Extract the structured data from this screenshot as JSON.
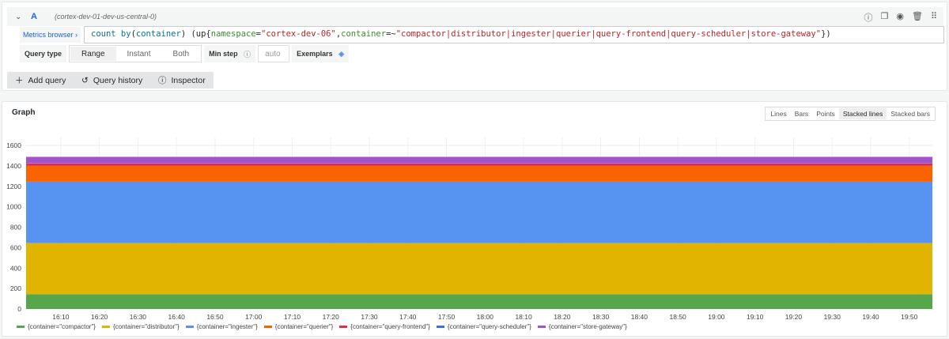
{
  "query": {
    "collapse_icon": "chevron-down-icon",
    "name": "A",
    "datasource": "(cortex-dev-01-dev-us-central-0)",
    "metrics_browser": "Metrics browser ›",
    "expr": {
      "fn": "count by",
      "lp1": "(",
      "arg": "container",
      "rp1": ")",
      " sp": " ",
      "up": "(up{",
      "k1": "namespace",
      "eq1": "=",
      "v1": "\"cortex-dev-06\"",
      "comma": ",",
      "k2": "container",
      "eq2": "=~",
      "v2": "\"compactor|distributor|ingester|querier|query-frontend|query-scheduler|store-gateway\"",
      "end": "})"
    },
    "query_type_label": "Query type",
    "query_types": [
      "Range",
      "Instant",
      "Both"
    ],
    "selected_type": "Range",
    "min_step_label": "Min step",
    "min_step_placeholder": "auto",
    "exemplars_label": "Exemplars"
  },
  "actions": {
    "add_query": "Add query",
    "query_history": "Query history",
    "inspector": "Inspector"
  },
  "graph": {
    "title": "Graph",
    "modes": [
      "Lines",
      "Bars",
      "Points",
      "Stacked lines",
      "Stacked bars"
    ],
    "selected_mode": "Stacked lines"
  },
  "chart_data": {
    "type": "area",
    "stacked": true,
    "grid": true,
    "legend_placement": "bottom",
    "x_range": [
      "16:01",
      "19:56"
    ],
    "x_ticks": [
      "16:10",
      "16:20",
      "16:30",
      "16:40",
      "16:50",
      "17:00",
      "17:10",
      "17:20",
      "17:30",
      "17:40",
      "17:50",
      "18:00",
      "18:10",
      "18:20",
      "18:30",
      "18:40",
      "18:50",
      "19:00",
      "19:10",
      "19:20",
      "19:30",
      "19:40",
      "19:50"
    ],
    "y_ticks": [
      0,
      200,
      400,
      600,
      800,
      1000,
      1200,
      1400,
      1600
    ],
    "ylim": [
      0,
      1650
    ],
    "series": [
      {
        "name": "{container=\"compactor\"}",
        "value": 145,
        "color": "#56a64b"
      },
      {
        "name": "{container=\"distributor\"}",
        "value": 500,
        "color": "#e0b400"
      },
      {
        "name": "{container=\"ingester\"}",
        "value": 600,
        "color": "#5794f2"
      },
      {
        "name": "{container=\"querier\"}",
        "value": 155,
        "color": "#fa6400"
      },
      {
        "name": "{container=\"query-frontend\"}",
        "value": 24,
        "color": "#e02f44"
      },
      {
        "name": "{container=\"query-scheduler\"}",
        "value": 4,
        "color": "#3274d9"
      },
      {
        "name": "{container=\"store-gateway\"}",
        "value": 60,
        "color": "#a352cc"
      }
    ]
  }
}
